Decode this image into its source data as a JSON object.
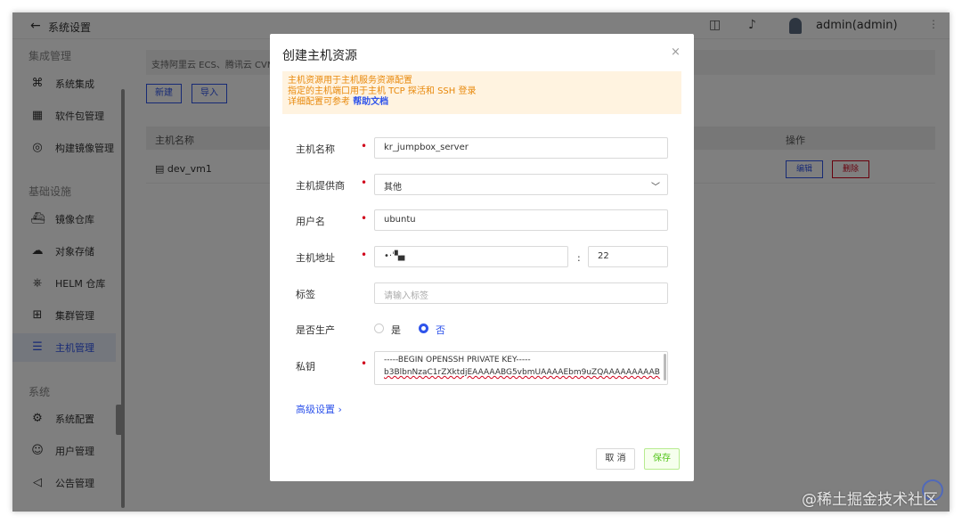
{
  "topbar": {
    "back_icon": "←",
    "title": "系统设置",
    "book_icon": "◫",
    "bell_icon": "♪",
    "user": "admin(admin)",
    "more_icon": "⋮"
  },
  "sidebar": {
    "sections": [
      "集成管理",
      "基础设施",
      "系统"
    ],
    "items": [
      {
        "label": "系统集成",
        "icon": "⌘"
      },
      {
        "label": "软件包管理",
        "icon": "▦"
      },
      {
        "label": "构建镜像管理",
        "icon": "◎"
      },
      {
        "label": "镜像仓库",
        "icon": "⛴"
      },
      {
        "label": "对象存储",
        "icon": "☁"
      },
      {
        "label": "HELM 仓库",
        "icon": "⎈"
      },
      {
        "label": "集群管理",
        "icon": "⊞"
      },
      {
        "label": "主机管理",
        "icon": "☰"
      },
      {
        "label": "系统配置",
        "icon": "⚙"
      },
      {
        "label": "用户管理",
        "icon": "☺"
      },
      {
        "label": "公告管理",
        "icon": "◁"
      }
    ]
  },
  "main": {
    "notice": "支持阿里云 ECS、腾讯云 CVM",
    "new_button": "新建",
    "import_button": "导入",
    "columns": {
      "name": "主机名称",
      "actions": "操作"
    },
    "row": {
      "name": "dev_vm1",
      "icon": "▤",
      "edit": "编辑",
      "delete": "删除"
    }
  },
  "modal": {
    "title": "创建主机资源",
    "close_icon": "×",
    "info": {
      "line1": "主机资源用于主机服务资源配置",
      "line2": "指定的主机端口用于主机 TCP 探活和 SSH 登录",
      "line3_prefix": "详细配置可参考",
      "line3_link": "帮助文档"
    },
    "fields": {
      "host_name": {
        "label": "主机名称",
        "value": "kr_jumpbox_server"
      },
      "provider": {
        "label": "主机提供商",
        "value": "其他",
        "chevron": "﹀"
      },
      "username": {
        "label": "用户名",
        "value": "ubuntu"
      },
      "address": {
        "label": "主机地址",
        "value": "•·ˈ▚▖",
        "colon": ":",
        "port": "22"
      },
      "tags": {
        "label": "标签",
        "placeholder": "请输入标签"
      },
      "production": {
        "label": "是否生产",
        "yes": "是",
        "no": "否",
        "selected": "否"
      },
      "private_key": {
        "label": "私钥",
        "line1": "-----BEGIN OPENSSH PRIVATE KEY-----",
        "line2": "b3BlbnNzaC1rZXktdjEAAAAABG5vbmUAAAAEbm9uZQAAAAAAAAAB"
      }
    },
    "required_mark": "•",
    "advanced": "高级设置 ›",
    "cancel": "取 消",
    "save": "保存"
  },
  "watermark": "@稀土掘金技术社区",
  "colors": {
    "primary": "#2f54eb",
    "danger": "#d0021b",
    "warning_bg": "#fff3e0",
    "warning_text": "#e8890c"
  }
}
